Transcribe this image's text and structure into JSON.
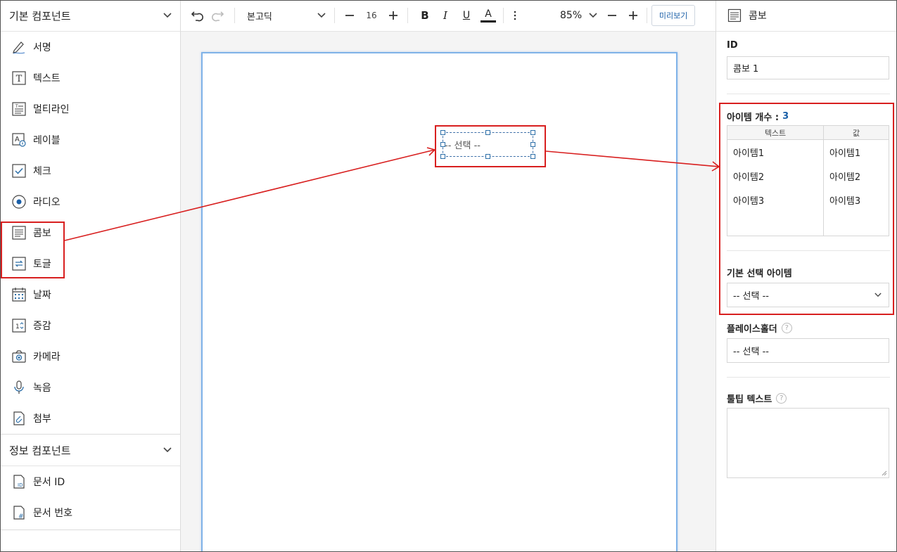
{
  "sidebar": {
    "basic_section_title": "기본 컴포넌트",
    "basic_items": [
      {
        "label": "서명",
        "icon": "pen-icon"
      },
      {
        "label": "텍스트",
        "icon": "text-t-icon"
      },
      {
        "label": "멀티라인",
        "icon": "multiline-icon"
      },
      {
        "label": "레이블",
        "icon": "label-icon"
      },
      {
        "label": "체크",
        "icon": "checkbox-icon"
      },
      {
        "label": "라디오",
        "icon": "radio-icon"
      },
      {
        "label": "콤보",
        "icon": "combo-icon"
      },
      {
        "label": "토글",
        "icon": "toggle-icon"
      },
      {
        "label": "날짜",
        "icon": "calendar-icon"
      },
      {
        "label": "증감",
        "icon": "stepper-icon"
      },
      {
        "label": "카메라",
        "icon": "camera-icon"
      },
      {
        "label": "녹음",
        "icon": "microphone-icon"
      },
      {
        "label": "첨부",
        "icon": "attachment-icon"
      }
    ],
    "info_section_title": "정보 컴포넌트",
    "info_items": [
      {
        "label": "문서 ID",
        "icon": "document-id-icon"
      },
      {
        "label": "문서 번호",
        "icon": "document-number-icon"
      }
    ]
  },
  "toolbar": {
    "font_name": "본고딕",
    "font_size": "16",
    "bold_label": "B",
    "italic_label": "I",
    "underline_label": "U",
    "color_label": "A",
    "zoom": "85%",
    "preview_label": "미리보기"
  },
  "canvas": {
    "combo_placeholder": "-- 선택 --"
  },
  "panel": {
    "title": "콤보",
    "id_label": "ID",
    "id_value": "콤보 1",
    "item_count_label": "아이템 개수 :",
    "item_count_value": "3",
    "table_headers": [
      "텍스트",
      "값"
    ],
    "table_rows": [
      {
        "text": "아이템1",
        "value": "아이템1"
      },
      {
        "text": "아이템2",
        "value": "아이템2"
      },
      {
        "text": "아이템3",
        "value": "아이템3"
      }
    ],
    "default_item_label": "기본 선택 아이템",
    "default_item_value": "-- 선택 --",
    "placeholder_label": "플레이스홀더",
    "placeholder_value": "-- 선택 --",
    "tooltip_label": "툴팁 텍스트",
    "help_glyph": "?"
  },
  "colors": {
    "highlight_red": "#d81f1f",
    "accent_blue": "#1a5fa8",
    "page_border": "#7fb2e8"
  }
}
